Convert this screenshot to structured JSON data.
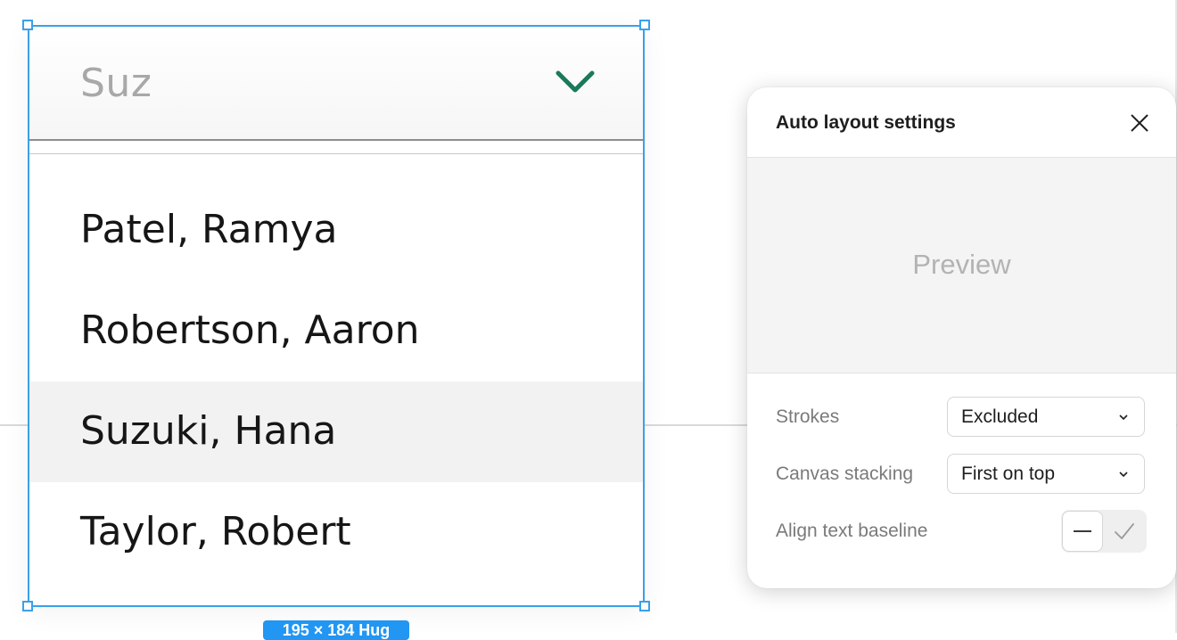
{
  "canvas": {
    "selection_size_label": "195 × 184 Hug",
    "accent_color": "#3aa0e8"
  },
  "combobox": {
    "input_value": "Suz",
    "chevron_icon": "chevron-down-icon",
    "chevron_color": "#1b7a57",
    "items": [
      {
        "label": "Patel, Ramya",
        "highlighted": false
      },
      {
        "label": "Robertson, Aaron",
        "highlighted": false
      },
      {
        "label": "Suzuki, Hana",
        "highlighted": true
      },
      {
        "label": "Taylor, Robert",
        "highlighted": false
      }
    ]
  },
  "panel": {
    "title": "Auto layout settings",
    "close_icon": "close-icon",
    "preview_label": "Preview",
    "rows": {
      "strokes": {
        "label": "Strokes",
        "value": "Excluded"
      },
      "canvas_stacking": {
        "label": "Canvas stacking",
        "value": "First on top"
      },
      "align_text_baseline": {
        "label": "Align text baseline",
        "off_icon": "dash-icon",
        "on_icon": "checkmark-icon",
        "selected": "off"
      }
    }
  }
}
